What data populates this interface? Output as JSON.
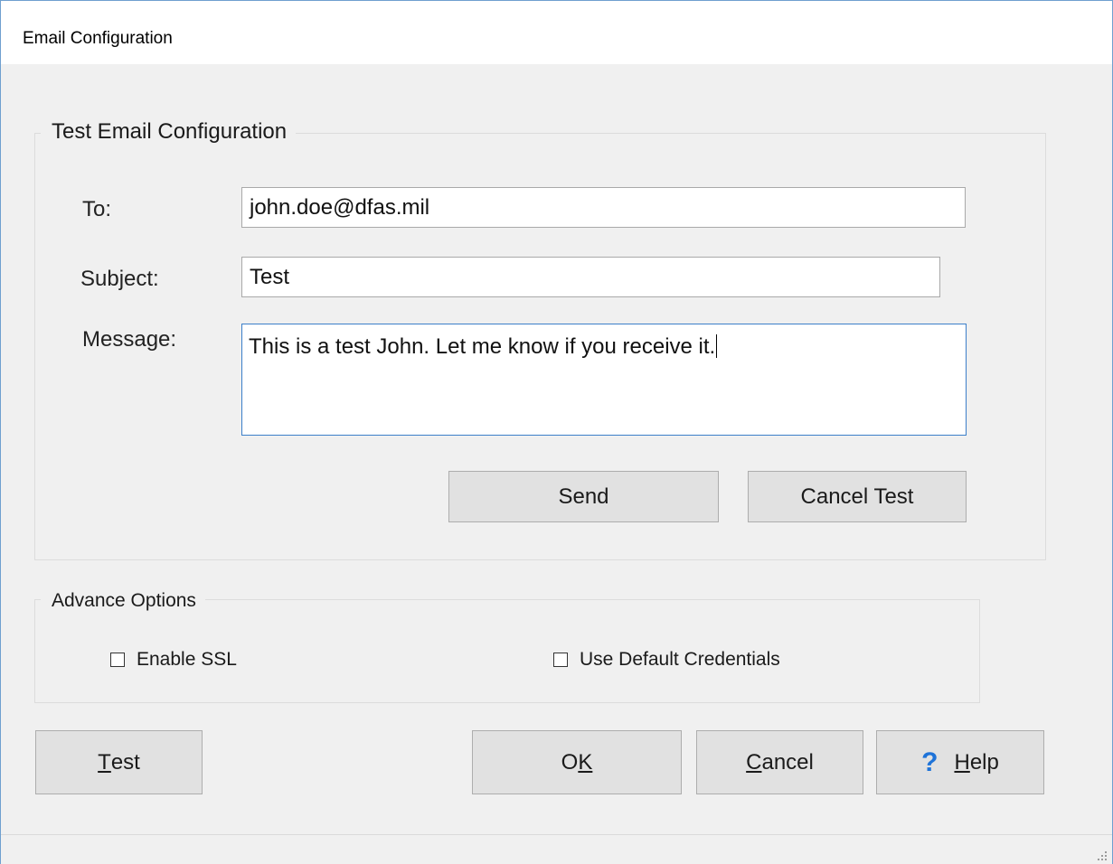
{
  "window": {
    "title": "Email Configuration"
  },
  "test_group": {
    "legend": "Test Email Configuration",
    "to_label": "To:",
    "to_value": "john.doe@dfas.mil",
    "subject_label": "Subject:",
    "subject_value": "Test",
    "message_label": "Message:",
    "message_value": "This is a test John.  Let me know if you receive it.",
    "send_label": "Send",
    "cancel_test_label": "Cancel Test"
  },
  "advanced_group": {
    "legend": "Advance Options",
    "enable_ssl": {
      "label": "Enable SSL",
      "checked": false
    },
    "use_default_credentials": {
      "label": "Use Default Credentials",
      "checked": false
    }
  },
  "buttons": {
    "test": {
      "mnemonic": "T",
      "rest": "est"
    },
    "ok": {
      "pre": "O",
      "mnemonic": "K"
    },
    "cancel": {
      "mnemonic": "C",
      "rest": "ancel"
    },
    "help": {
      "icon": "help-question-icon",
      "icon_glyph": "?",
      "mnemonic": "H",
      "rest": "elp"
    }
  },
  "colors": {
    "accent": "#1e73d8",
    "focus_border": "#3c7fc9",
    "window_border": "#6f9fcf"
  }
}
